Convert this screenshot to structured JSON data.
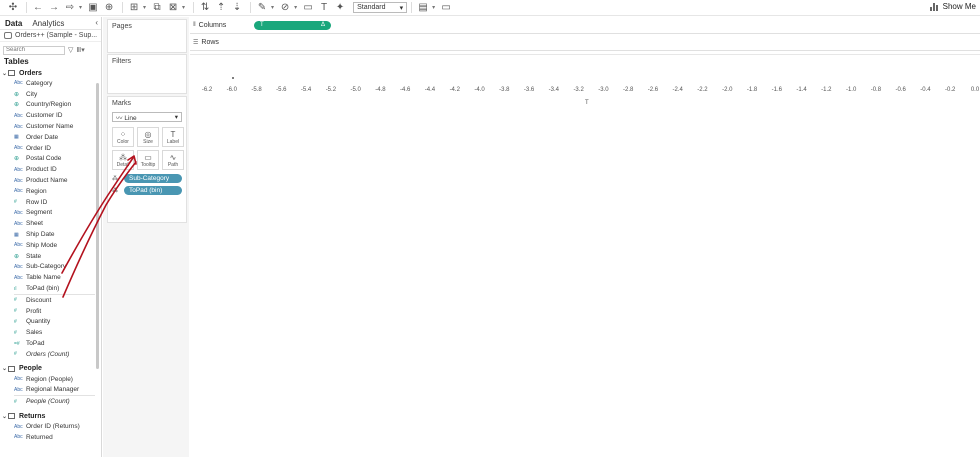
{
  "toolbar": {
    "fit_value": "Standard",
    "show_me_label": "Show Me",
    "icons": [
      "tableau-logo-icon",
      "undo-icon",
      "redo-icon",
      "replay-icon",
      "save-icon",
      "new-datasource-icon",
      "new-sheet-icon",
      "duplicate-icon",
      "clear-icon",
      "swap-icon",
      "sort-asc-icon",
      "sort-desc-icon",
      "group-icon",
      "label-icon",
      "fix-axes-icon",
      "highlight-icon",
      "tooltip-icon",
      "text-icon",
      "pin-icon",
      "presentation-icon"
    ]
  },
  "data_pane": {
    "tab_data": "Data",
    "tab_analytics": "Analytics",
    "datasource": "Orders++ (Sample - Sup...",
    "search_placeholder": "Search",
    "tables_header": "Tables",
    "groups": [
      {
        "name": "Orders",
        "dimensions": [
          {
            "type": "Abc",
            "name": "Category"
          },
          {
            "type": "geo",
            "name": "City"
          },
          {
            "type": "geo",
            "name": "Country/Region"
          },
          {
            "type": "Abc",
            "name": "Customer ID"
          },
          {
            "type": "Abc",
            "name": "Customer Name"
          },
          {
            "type": "date",
            "name": "Order Date"
          },
          {
            "type": "Abc",
            "name": "Order ID"
          },
          {
            "type": "geo",
            "name": "Postal Code"
          },
          {
            "type": "Abc",
            "name": "Product ID"
          },
          {
            "type": "Abc",
            "name": "Product Name"
          },
          {
            "type": "Abc",
            "name": "Region"
          },
          {
            "type": "num",
            "name": "Row ID"
          },
          {
            "type": "Abc",
            "name": "Segment"
          },
          {
            "type": "Abc",
            "name": "Sheet"
          },
          {
            "type": "date",
            "name": "Ship Date"
          },
          {
            "type": "Abc",
            "name": "Ship Mode"
          },
          {
            "type": "geo",
            "name": "State"
          },
          {
            "type": "Abc",
            "name": "Sub-Category"
          },
          {
            "type": "Abc",
            "name": "Table Name"
          },
          {
            "type": "bin",
            "name": "ToPad (bin)"
          }
        ],
        "measures": [
          {
            "type": "num",
            "name": "Discount"
          },
          {
            "type": "num",
            "name": "Profit"
          },
          {
            "type": "num",
            "name": "Quantity"
          },
          {
            "type": "num",
            "name": "Sales"
          },
          {
            "type": "calc",
            "name": "ToPad"
          },
          {
            "type": "num",
            "name": "Orders (Count)",
            "italic": true
          }
        ]
      },
      {
        "name": "People",
        "dimensions": [
          {
            "type": "Abc",
            "name": "Region (People)"
          },
          {
            "type": "Abc",
            "name": "Regional Manager"
          }
        ],
        "measures": [
          {
            "type": "num",
            "name": "People (Count)",
            "italic": true
          }
        ]
      },
      {
        "name": "Returns",
        "dimensions": [
          {
            "type": "Abc",
            "name": "Order ID (Returns)"
          },
          {
            "type": "Abc",
            "name": "Returned"
          }
        ],
        "measures": []
      }
    ]
  },
  "cards": {
    "pages": "Pages",
    "filters": "Filters",
    "marks": "Marks",
    "mark_type": "Line",
    "buttons": [
      {
        "icon": "color-icon",
        "label": "Color"
      },
      {
        "icon": "size-icon",
        "label": "Size"
      },
      {
        "icon": "label-icon",
        "label": "Label"
      },
      {
        "icon": "detail-icon",
        "label": "Detail"
      },
      {
        "icon": "tooltip-icon",
        "label": "Tooltip"
      },
      {
        "icon": "path-icon",
        "label": "Path"
      }
    ],
    "pills": [
      "Sub-Category",
      "ToPad (bin)"
    ]
  },
  "shelves": {
    "columns_label": "Columns",
    "rows_label": "Rows",
    "columns_pill": "T",
    "columns_pill_delta": "Δ"
  },
  "view": {
    "axis_ticks": [
      "-6.2",
      "-6.0",
      "-5.8",
      "-5.6",
      "-5.4",
      "-5.2",
      "-5.0",
      "-4.8",
      "-4.6",
      "-4.4",
      "-4.2",
      "-4.0",
      "-3.8",
      "-3.6",
      "-3.4",
      "-3.2",
      "-3.0",
      "-2.8",
      "-2.6",
      "-2.4",
      "-2.2",
      "-2.0",
      "-1.8",
      "-1.6",
      "-1.4",
      "-1.2",
      "-1.0",
      "-0.8",
      "-0.6",
      "-0.4",
      "-0.2",
      "0.0"
    ],
    "axis_title": "T"
  },
  "colors": {
    "columns_pill": "#1aa77c",
    "marks_pill": "#4996b2",
    "annotation": "#b3121e"
  }
}
